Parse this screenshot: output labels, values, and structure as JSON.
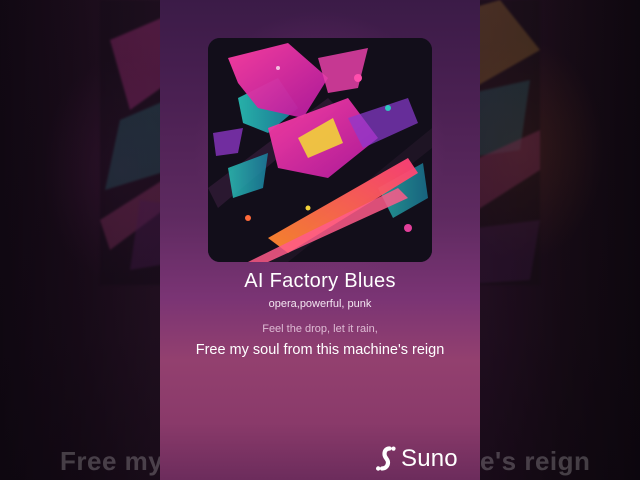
{
  "song": {
    "title": "AI Factory Blues",
    "tags": "opera,powerful, punk"
  },
  "lyrics": {
    "previous_line": "Feel the drop, let it rain,",
    "current_line": "Free my soul from this machine's reign",
    "background_left": "Free my",
    "background_right": "e's reign"
  },
  "brand": {
    "name": "Suno",
    "logo_icon": "suno-logo-icon"
  },
  "colors": {
    "card_top": "#3b1b47",
    "card_bottom": "#93406f",
    "text": "#ffffff"
  }
}
